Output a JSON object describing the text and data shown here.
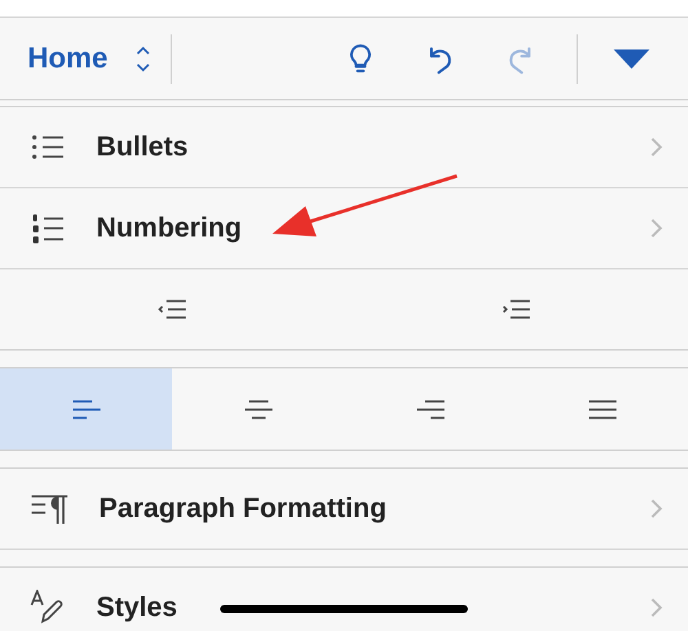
{
  "toolbar": {
    "tab_label": "Home",
    "actions": [
      {
        "kind": "idea",
        "disabled": false
      },
      {
        "kind": "undo",
        "disabled": false
      },
      {
        "kind": "redo",
        "disabled": true
      }
    ]
  },
  "sections": [
    {
      "kind": "nav",
      "items": [
        {
          "label": "Bullets"
        },
        {
          "label": "Numbering"
        }
      ]
    },
    {
      "kind": "indent",
      "buttons": [
        {
          "kind": "decrease"
        },
        {
          "kind": "increase"
        }
      ]
    },
    {
      "kind": "align",
      "buttons": [
        {
          "kind": "left",
          "selected": true
        },
        {
          "kind": "center",
          "selected": false
        },
        {
          "kind": "right",
          "selected": false
        },
        {
          "kind": "justify",
          "selected": false
        }
      ]
    },
    {
      "kind": "nav",
      "items": [
        {
          "label": "Paragraph Formatting"
        }
      ]
    },
    {
      "kind": "nav",
      "items": [
        {
          "label": "Styles"
        }
      ]
    }
  ]
}
